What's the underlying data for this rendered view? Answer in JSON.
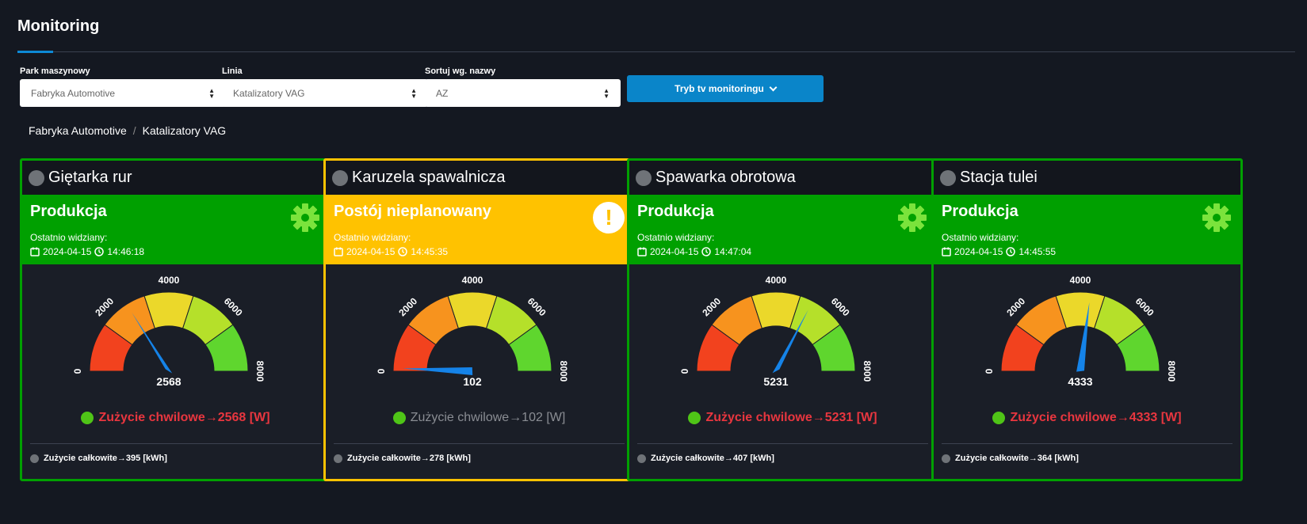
{
  "header": {
    "title": "Monitoring"
  },
  "filters": [
    {
      "label": "Park maszynowy",
      "value": "Fabryka Automotive"
    },
    {
      "label": "Linia",
      "value": "Katalizatory VAG"
    },
    {
      "label": "Sortuj wg. nazwy",
      "value": "AZ"
    }
  ],
  "tv_button": {
    "label": "Tryb tv monitoringu"
  },
  "breadcrumb": [
    "Fabryka Automotive",
    "Katalizatory VAG"
  ],
  "gauge": {
    "min": 0,
    "max": 8000,
    "ticks": [
      "0",
      "2000",
      "4000",
      "6000",
      "8000"
    ],
    "colors": [
      "#f2421e",
      "#f7931e",
      "#ebd82a",
      "#b5e02a",
      "#5fd62e"
    ]
  },
  "machines": [
    {
      "name": "Giętarka rur",
      "status": "Produkcja",
      "status_color": "#00a000",
      "last_seen_label": "Ostatnio widziany:",
      "date": "2024-04-15",
      "time": "14:46:18",
      "value": 2568,
      "value_text": "2568",
      "usage_text": "Zużycie chwilowe→2568 [W]",
      "total_text": "Zużycie całkowite→395 [kWh]",
      "icon": "gear-icon"
    },
    {
      "name": "Karuzela spawalnicza",
      "status": "Postój nieplanowany",
      "status_color": "#ffc200",
      "last_seen_label": "Ostatnio widziany:",
      "date": "2024-04-15",
      "time": "14:45:35",
      "value": 102,
      "value_text": "102",
      "usage_text": "Zużycie chwilowe→102 [W]",
      "total_text": "Zużycie całkowite→278 [kWh]",
      "icon": "warning-icon"
    },
    {
      "name": "Spawarka obrotowa",
      "status": "Produkcja",
      "status_color": "#00a000",
      "last_seen_label": "Ostatnio widziany:",
      "date": "2024-04-15",
      "time": "14:47:04",
      "value": 5231,
      "value_text": "5231",
      "usage_text": "Zużycie chwilowe→5231 [W]",
      "total_text": "Zużycie całkowite→407 [kWh]",
      "icon": "gear-icon"
    },
    {
      "name": "Stacja tulei",
      "status": "Produkcja",
      "status_color": "#00a000",
      "last_seen_label": "Ostatnio widziany:",
      "date": "2024-04-15",
      "time": "14:45:55",
      "value": 4333,
      "value_text": "4333",
      "usage_text": "Zużycie chwilowe→4333 [W]",
      "total_text": "Zużycie całkowite→364 [kWh]",
      "icon": "gear-icon"
    }
  ]
}
